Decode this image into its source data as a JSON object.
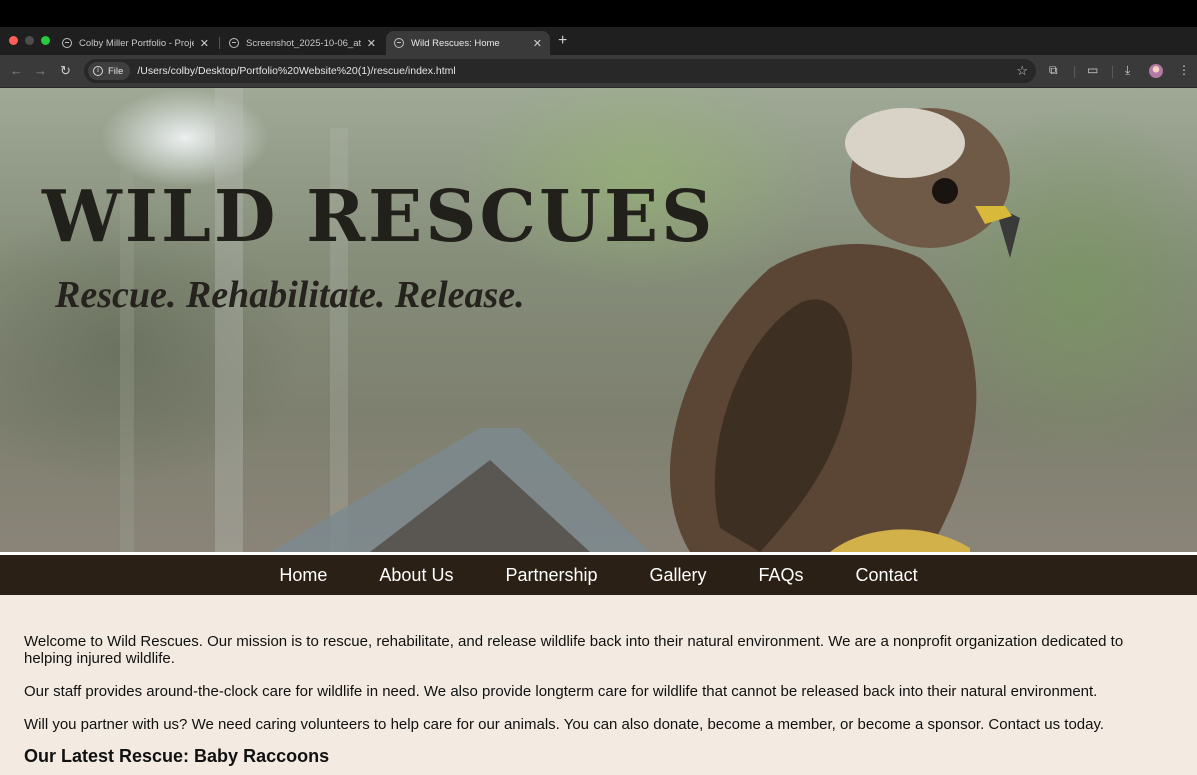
{
  "browser": {
    "tabs": [
      {
        "title": "Colby Miller Portfolio - Projec",
        "active": false
      },
      {
        "title": "Screenshot_2025-10-06_at_",
        "active": false
      },
      {
        "title": "Wild Rescues: Home",
        "active": true
      }
    ],
    "new_tab_label": "+",
    "address": {
      "scheme_chip": "File",
      "url": "/Users/colby/Desktop/Portfolio%20Website%20(1)/rescue/index.html"
    }
  },
  "hero": {
    "title": "WILD RESCUES",
    "tagline": "Rescue. Rehabilitate. Release."
  },
  "nav": {
    "items": [
      "Home",
      "About Us",
      "Partnership",
      "Gallery",
      "FAQs",
      "Contact"
    ]
  },
  "main": {
    "paragraphs": [
      "Welcome to Wild Rescues. Our mission is to rescue, rehabilitate, and release wildlife back into their natural environment. We are a nonprofit organization dedicated to helping injured wildlife.",
      "Our staff provides around-the-clock care for wildlife in need. We also provide longterm care for wildlife that cannot be released back into their natural environment.",
      "Will you partner with us? We need caring volunteers to help care for our animals. You can also donate, become a member, or become a sponsor. Contact us today."
    ],
    "latest_heading": "Our Latest Rescue: Baby Raccoons"
  },
  "colors": {
    "nav_background": "#2b2015",
    "page_background": "#f3ebe1",
    "brand_text": "#22201b"
  },
  "icons": {
    "back": "arrow-left-icon",
    "forward": "arrow-right-icon",
    "reload": "reload-icon",
    "bookmark": "star-icon",
    "extensions": "puzzle-icon",
    "download": "download-icon",
    "menu": "kebab-menu-icon"
  }
}
